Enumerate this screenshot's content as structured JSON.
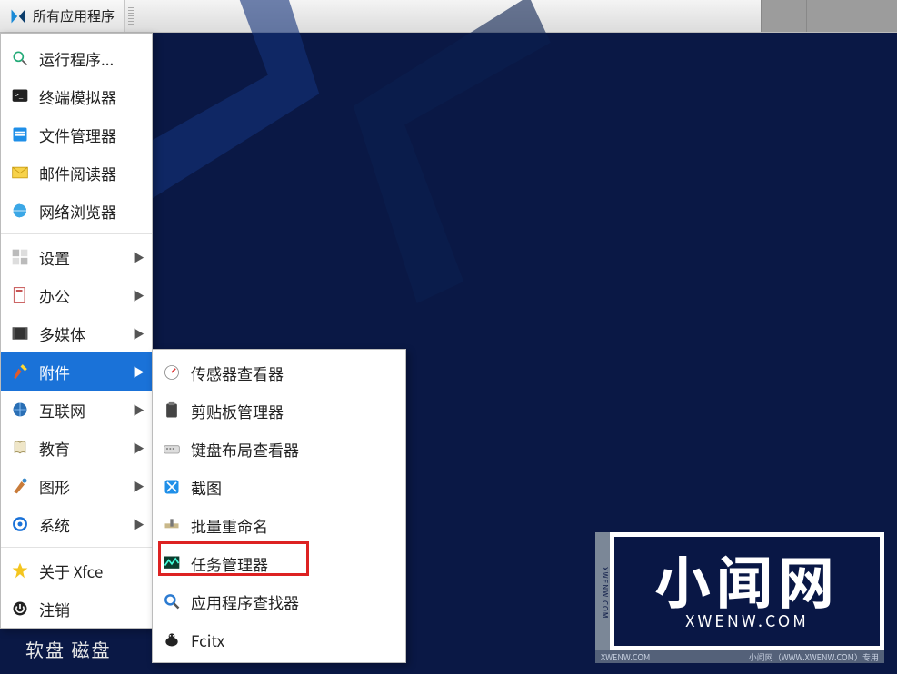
{
  "taskbar": {
    "app_button_label": "所有应用程序"
  },
  "menu": {
    "items": [
      {
        "label": "运行程序...",
        "icon": "search-icon",
        "submenu": false
      },
      {
        "label": "终端模拟器",
        "icon": "terminal-icon",
        "submenu": false
      },
      {
        "label": "文件管理器",
        "icon": "folder-icon",
        "submenu": false
      },
      {
        "label": "邮件阅读器",
        "icon": "mail-icon",
        "submenu": false
      },
      {
        "label": "网络浏览器",
        "icon": "globe-icon",
        "submenu": false
      },
      {
        "label": "设置",
        "icon": "settings-icon",
        "submenu": true
      },
      {
        "label": "办公",
        "icon": "office-icon",
        "submenu": true
      },
      {
        "label": "多媒体",
        "icon": "media-icon",
        "submenu": true
      },
      {
        "label": "附件",
        "icon": "accessories-icon",
        "submenu": true,
        "highlight": true
      },
      {
        "label": "互联网",
        "icon": "internet-icon",
        "submenu": true
      },
      {
        "label": "教育",
        "icon": "education-icon",
        "submenu": true
      },
      {
        "label": "图形",
        "icon": "graphics-icon",
        "submenu": true
      },
      {
        "label": "系统",
        "icon": "system-icon",
        "submenu": true
      },
      {
        "label": "关于 Xfce",
        "icon": "star-icon",
        "submenu": false
      },
      {
        "label": "注销",
        "icon": "logout-icon",
        "submenu": false
      }
    ]
  },
  "submenu": {
    "items": [
      {
        "label": "传感器查看器",
        "icon": "sensor-icon"
      },
      {
        "label": "剪贴板管理器",
        "icon": "clipboard-icon"
      },
      {
        "label": "键盘布局查看器",
        "icon": "keyboard-icon"
      },
      {
        "label": "截图",
        "icon": "screenshot-icon"
      },
      {
        "label": "批量重命名",
        "icon": "rename-icon"
      },
      {
        "label": "任务管理器",
        "icon": "taskmgr-icon",
        "annotated": true
      },
      {
        "label": "应用程序查找器",
        "icon": "appfinder-icon"
      },
      {
        "label": "Fcitx",
        "icon": "fcitx-icon"
      }
    ]
  },
  "desktop": {
    "icon_label": "软盘 磁盘"
  },
  "watermark": {
    "main": "小闻网",
    "sub": "XWENW.COM",
    "side": "XWENW.COM",
    "strip_left": "XWENW.COM",
    "strip_right": "小闻网（WWW.XWENW.COM）专用"
  }
}
